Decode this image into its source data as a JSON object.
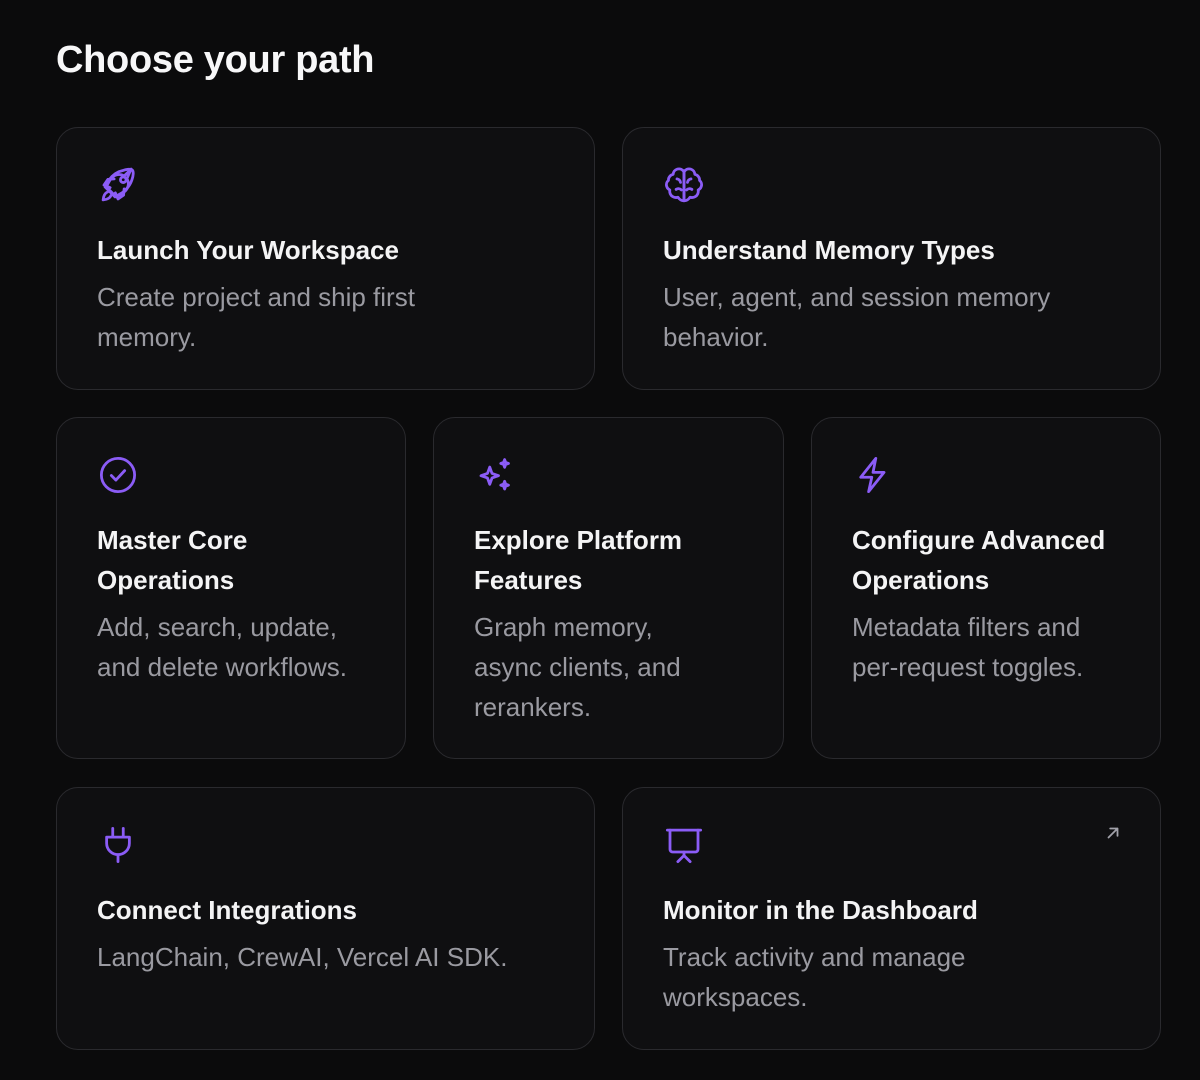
{
  "page": {
    "title": "Choose your path"
  },
  "colors": {
    "background": "#0b0b0c",
    "card_background": "#0f0f11",
    "card_border": "#2a2a2e",
    "accent": "#8b5cf6",
    "title_text": "#f4f4f5",
    "muted_text": "#9a9aa1"
  },
  "cards": [
    {
      "icon": "rocket-icon",
      "title": "Launch Your Workspace",
      "description": "Create project and ship first memory."
    },
    {
      "icon": "brain-icon",
      "title": "Understand Memory Types",
      "description": "User, agent, and session memory behavior."
    },
    {
      "icon": "check-circle-icon",
      "title": "Master Core Operations",
      "description": "Add, search, update, and delete workflows."
    },
    {
      "icon": "sparkles-icon",
      "title": "Explore Platform Features",
      "description": "Graph memory, async clients, and rerankers."
    },
    {
      "icon": "lightning-icon",
      "title": "Configure Advanced Operations",
      "description": "Metadata filters and per-request toggles."
    },
    {
      "icon": "plug-icon",
      "title": "Connect Integrations",
      "description": "LangChain, CrewAI, Vercel AI SDK."
    },
    {
      "icon": "presentation-screen-icon",
      "title": "Monitor in the Dashboard",
      "description": "Track activity and manage workspaces.",
      "external_link_icon": "external-link-arrow-icon"
    }
  ]
}
